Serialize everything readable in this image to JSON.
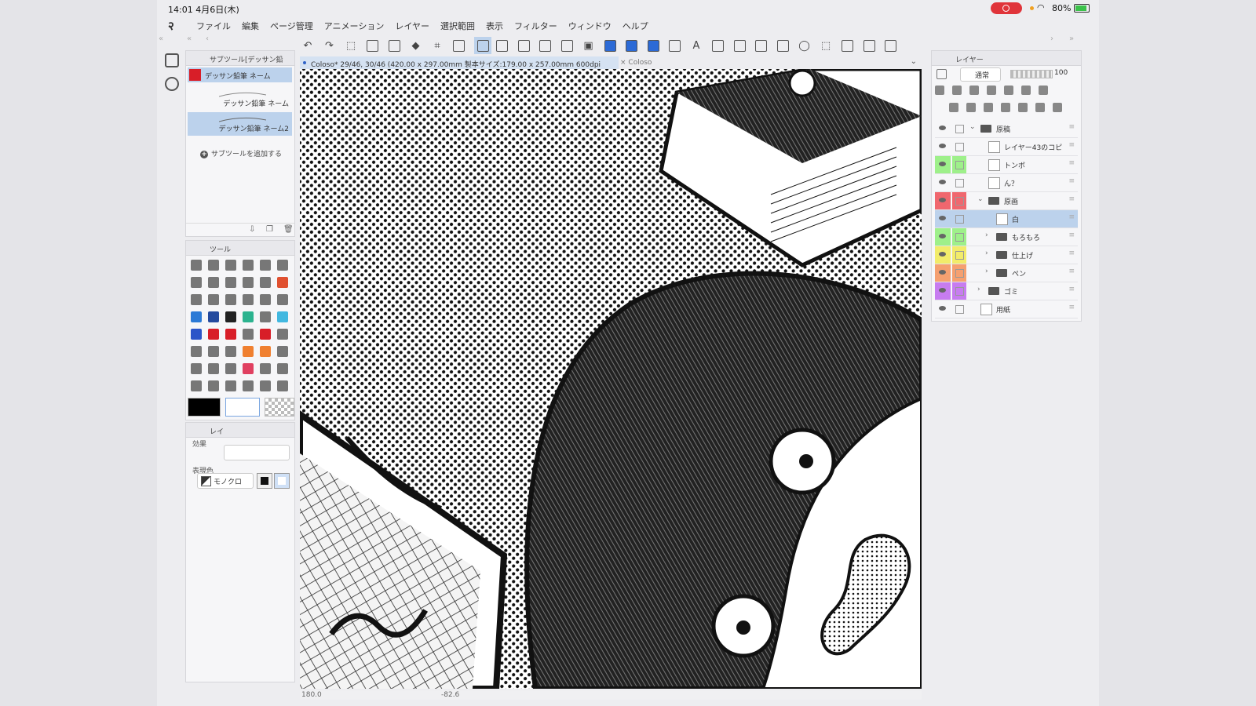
{
  "statusbar": {
    "time": "14:01 4月6日(木)",
    "battery": "80%"
  },
  "menu": [
    "ファイル",
    "編集",
    "ページ管理",
    "アニメーション",
    "レイヤー",
    "選択範囲",
    "表示",
    "フィルター",
    "ウィンドウ",
    "ヘルプ"
  ],
  "subtool_panel": {
    "title": "サブツール[デッサン鉛",
    "selected_tool": "デッサン鉛筆 ネーム",
    "items": [
      "デッサン鉛筆 ネーム",
      "デッサン鉛筆 ネーム2"
    ],
    "add_label": "サブツールを追加する"
  },
  "tool_panel": {
    "title": "ツール"
  },
  "property_panel": {
    "tab": "レイ",
    "effect_label": "効果",
    "expression_label": "表現色",
    "expression_value": "モノクロ"
  },
  "document": {
    "tab_title": "Coloso* 29/46, 30/46 (420.00 x 297.00mm 製本サイズ:179.00 x 257.00mm 600dpi 180.0%)",
    "tab2_title": "Coloso",
    "zoom": "180.0",
    "angle": "-82.6"
  },
  "layers_panel": {
    "title": "レイヤー",
    "blend_mode": "通常",
    "opacity": "100",
    "layers": [
      {
        "name": "原稿",
        "type": "folder",
        "indent": 0,
        "expanded": true,
        "color": ""
      },
      {
        "name": "レイヤー43のコピ",
        "type": "raster",
        "indent": 1,
        "color": ""
      },
      {
        "name": "トンボ",
        "type": "raster",
        "indent": 1,
        "color": "#9ef08a"
      },
      {
        "name": "ん？",
        "type": "text",
        "indent": 1,
        "color": ""
      },
      {
        "name": "原画",
        "type": "folder",
        "indent": 1,
        "expanded": true,
        "color": "#f0676e"
      },
      {
        "name": "白",
        "type": "raster",
        "indent": 2,
        "color": "",
        "selected": true
      },
      {
        "name": "もろもろ",
        "type": "folder",
        "indent": 2,
        "color": "#9ef08a"
      },
      {
        "name": "仕上げ",
        "type": "folder",
        "indent": 2,
        "color": "#f2ec6a"
      },
      {
        "name": "ペン",
        "type": "folder",
        "indent": 2,
        "color": "#f5a070"
      },
      {
        "name": "ゴミ",
        "type": "folder",
        "indent": 1,
        "color": "#c77cf0"
      },
      {
        "name": "用紙",
        "type": "paper",
        "indent": 0,
        "color": ""
      }
    ]
  },
  "colors": {
    "main": "#000000",
    "sub": "#ffffff",
    "accent": "#2e62c8",
    "selection": "#bcd2ec"
  }
}
